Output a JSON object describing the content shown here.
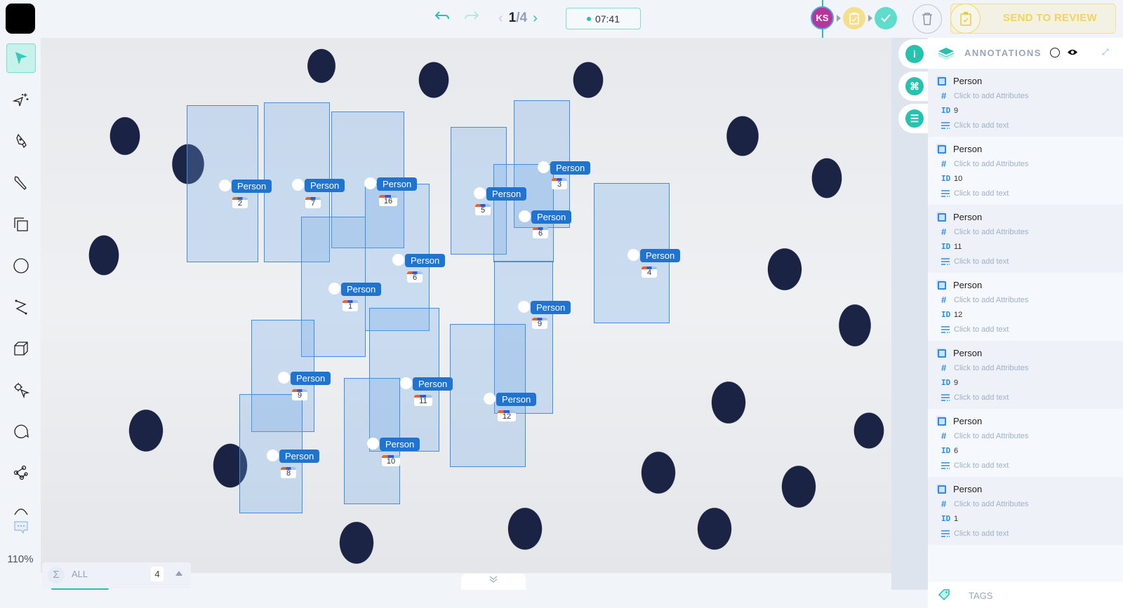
{
  "topbar": {
    "undo_icon": "undo-arrow-icon",
    "redo_icon": "redo-arrow-icon",
    "page_current": "1",
    "page_separator": "/",
    "page_total": "4",
    "prev_icon": "‹",
    "next_icon": "›",
    "timer": "07:41",
    "avatar_initials": "KS",
    "send_to_review_label": "SEND TO REVIEW",
    "colors": {
      "accent": "#25c2b0",
      "avatar": "#b7349a",
      "review": "#f2d45c",
      "box": "#3f8de8",
      "tag": "#1f74d1"
    }
  },
  "toolbar": {
    "tools": [
      {
        "name": "select",
        "icon": "cursor-arrow-icon",
        "active": true
      },
      {
        "name": "magic",
        "icon": "magic-cursor-icon",
        "active": false
      },
      {
        "name": "pen",
        "icon": "pen-nib-icon",
        "active": false
      },
      {
        "name": "brush",
        "icon": "brush-icon",
        "active": false
      },
      {
        "name": "bounding-box",
        "icon": "bounding-box-icon",
        "active": false
      },
      {
        "name": "ellipse",
        "icon": "circle-icon",
        "active": false
      },
      {
        "name": "polyline",
        "icon": "polyline-icon",
        "active": false
      },
      {
        "name": "cuboid",
        "icon": "cube-icon",
        "active": false
      },
      {
        "name": "point",
        "icon": "point-cursor-icon",
        "active": false
      },
      {
        "name": "comment",
        "icon": "speech-bubble-icon",
        "active": false
      },
      {
        "name": "skeleton",
        "icon": "skeleton-nodes-icon",
        "active": false
      }
    ],
    "zoom_level": "110%"
  },
  "canvas": {
    "annotations": [
      {
        "label": "Person",
        "id": "2"
      },
      {
        "label": "Person",
        "id": "7"
      },
      {
        "label": "Person",
        "id": "16"
      },
      {
        "label": "Person",
        "id": "3"
      },
      {
        "label": "Person",
        "id": "5"
      },
      {
        "label": "Person",
        "id": "6"
      },
      {
        "label": "Person",
        "id": "6"
      },
      {
        "label": "Person",
        "id": "4"
      },
      {
        "label": "Person",
        "id": "1"
      },
      {
        "label": "Person",
        "id": "9"
      },
      {
        "label": "Person",
        "id": "9"
      },
      {
        "label": "Person",
        "id": "11"
      },
      {
        "label": "Person",
        "id": "12"
      },
      {
        "label": "Person",
        "id": "8"
      },
      {
        "label": "Person",
        "id": "10"
      }
    ]
  },
  "filter": {
    "sigma_icon": "Σ",
    "label": "ALL",
    "count": "4"
  },
  "scroll_toggle_icon": "»",
  "rail": {
    "info_icon": "i",
    "shortcuts_icon": "⌘",
    "settings_icon": "☰"
  },
  "panel": {
    "title": "ANNOTATIONS",
    "items": [
      {
        "class": "Person",
        "attributes_placeholder": "Click to add Attributes",
        "id_label": "ID",
        "id": "9",
        "text_placeholder": "Click to add text"
      },
      {
        "class": "Person",
        "attributes_placeholder": "Click to add Attributes",
        "id_label": "ID",
        "id": "10",
        "text_placeholder": "Click to add text"
      },
      {
        "class": "Person",
        "attributes_placeholder": "Click to add Attributes",
        "id_label": "ID",
        "id": "11",
        "text_placeholder": "Click to add text"
      },
      {
        "class": "Person",
        "attributes_placeholder": "Click to add Attributes",
        "id_label": "ID",
        "id": "12",
        "text_placeholder": "Click to add text"
      },
      {
        "class": "Person",
        "attributes_placeholder": "Click to add Attributes",
        "id_label": "ID",
        "id": "9",
        "text_placeholder": "Click to add text"
      },
      {
        "class": "Person",
        "attributes_placeholder": "Click to add Attributes",
        "id_label": "ID",
        "id": "6",
        "text_placeholder": "Click to add text"
      },
      {
        "class": "Person",
        "attributes_placeholder": "Click to add Attributes",
        "id_label": "ID",
        "id": "1",
        "text_placeholder": "Click to add text"
      }
    ],
    "tags_label": "TAGS"
  }
}
